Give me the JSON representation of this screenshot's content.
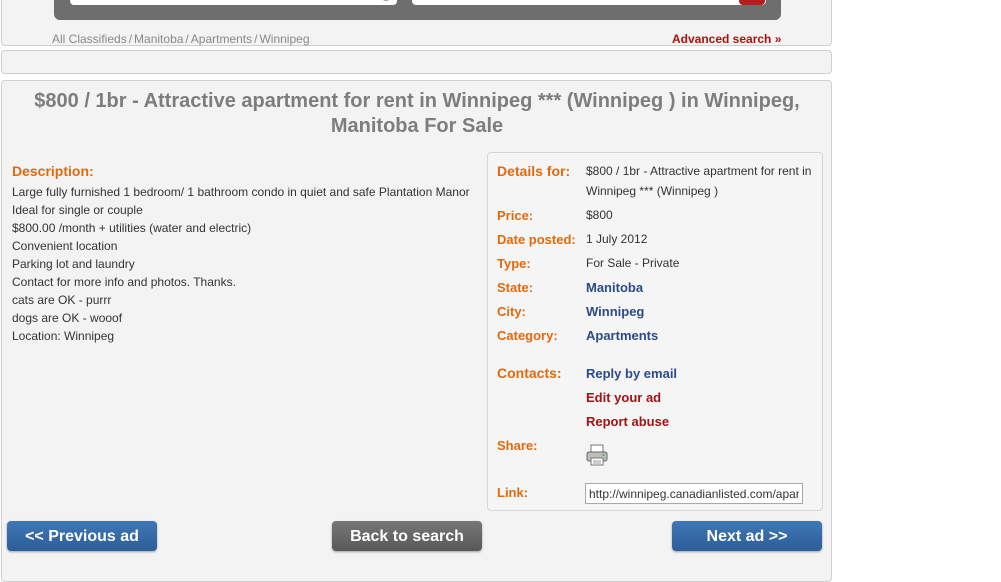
{
  "breadcrumb": {
    "items": [
      "All Classifieds",
      "Manitoba",
      "Apartments",
      "Winnipeg"
    ],
    "separator": "/"
  },
  "advanced_search_label": "Advanced search »",
  "ad": {
    "title": "$800 / 1br - Attractive apartment for rent in Winnipeg *** (Winnipeg ) in Winnipeg, Manitoba For Sale",
    "description_heading": "Description:",
    "description_lines": [
      "Large fully furnished 1 bedroom/ 1 bathroom condo in quiet and safe Plantation Manor",
      "Ideal for single or couple",
      "$800.00 /month + utilities (water and electric)",
      "Convenient location",
      "Parking lot and laundry",
      "Contact for more info and photos. Thanks.",
      "cats are OK - purrr",
      "dogs are OK - wooof",
      "Location: Winnipeg"
    ]
  },
  "details": {
    "details_for_label": "Details for:",
    "details_for_value": "$800 / 1br - Attractive apartment for rent in Winnipeg *** (Winnipeg )",
    "price_label": "Price:",
    "price_value": "$800",
    "date_label": "Date posted:",
    "date_value": "1 July 2012",
    "type_label": "Type:",
    "type_value": "For Sale - Private",
    "state_label": "State:",
    "state_value": "Manitoba",
    "city_label": "City:",
    "city_value": "Winnipeg",
    "category_label": "Category:",
    "category_value": "Apartments",
    "contacts_label": "Contacts:",
    "reply_label": "Reply by email",
    "edit_label": "Edit your ad",
    "report_label": "Report abuse",
    "share_label": "Share:",
    "link_label": "Link:",
    "link_value": "http://winnipeg.canadianlisted.com/apartments/"
  },
  "nav": {
    "prev_label": "<< Previous ad",
    "back_label": "Back to search",
    "next_label": "Next ad >>"
  },
  "colors": {
    "label_orange": "#e06a0f",
    "link_blue": "#2c4a8a",
    "link_red": "#a01414",
    "button_blue": "#2c5e99",
    "button_grey": "#595959"
  }
}
